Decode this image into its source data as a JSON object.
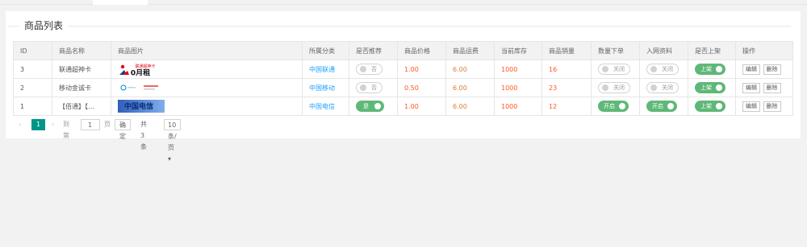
{
  "page": {
    "title": "商品列表"
  },
  "table": {
    "headers": [
      "ID",
      "商品名称",
      "商品图片",
      "所属分类",
      "是否推荐",
      "商品价格",
      "商品运费",
      "当前库存",
      "商品销量",
      "数量下单",
      "入网资料",
      "是否上架",
      "操作"
    ],
    "rows": [
      {
        "id": "3",
        "name": "联通超神卡",
        "image_text": "联通超神卡",
        "category": "中国联通",
        "recommend": "否",
        "price": "1.00",
        "shipping": "6.00",
        "stock": "1000",
        "sales": "16",
        "qty_order": "关闭",
        "network_info": "关闭",
        "listed": "上架",
        "recommend_on": false,
        "qty_order_on": false,
        "network_info_on": false,
        "listed_on": true
      },
      {
        "id": "2",
        "name": "移动金诚卡",
        "image_text": "",
        "category": "中国移动",
        "recommend": "否",
        "price": "0.50",
        "shipping": "6.00",
        "stock": "1000",
        "sales": "23",
        "qty_order": "关闭",
        "network_info": "关闭",
        "listed": "上架",
        "recommend_on": false,
        "qty_order_on": false,
        "network_info_on": false,
        "listed_on": true
      },
      {
        "id": "1",
        "name": "【佰通】【…",
        "image_text": "中国电信",
        "category": "中国电信",
        "recommend": "是",
        "price": "1.00",
        "shipping": "6.00",
        "stock": "1000",
        "sales": "12",
        "qty_order": "开启",
        "network_info": "开启",
        "listed": "上架",
        "recommend_on": true,
        "qty_order_on": true,
        "network_info_on": true,
        "listed_on": true
      }
    ],
    "actions": {
      "edit": "编辑",
      "delete": "删除"
    }
  },
  "pager": {
    "prev": "‹",
    "current": "1",
    "next": "›",
    "goto_label": "到第",
    "goto_value": "1",
    "page_unit": "页",
    "confirm": "确定",
    "total": "共 3 条",
    "per_page": "10 条/页"
  },
  "colors": {
    "accent": "#009688",
    "switch_on": "#5fb878",
    "link": "#1e9fff",
    "price": "#ff5722"
  }
}
